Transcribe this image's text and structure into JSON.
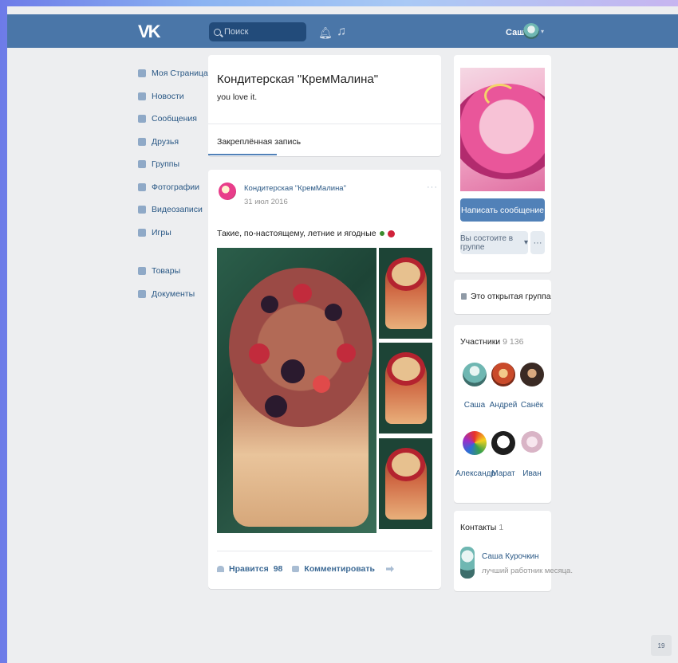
{
  "header": {
    "logo": "VK",
    "search_placeholder": "Поиск",
    "user_name": "Саша"
  },
  "sidebar": {
    "items": [
      {
        "label": "Моя Страница",
        "icon": "home-icon"
      },
      {
        "label": "Новости",
        "icon": "news-icon"
      },
      {
        "label": "Сообщения",
        "icon": "messages-icon"
      },
      {
        "label": "Друзья",
        "icon": "friends-icon"
      },
      {
        "label": "Группы",
        "icon": "groups-icon"
      },
      {
        "label": "Фотографии",
        "icon": "photos-icon"
      },
      {
        "label": "Видеозаписи",
        "icon": "videos-icon"
      },
      {
        "label": "Игры",
        "icon": "games-icon"
      }
    ],
    "extra_items": [
      {
        "label": "Товары",
        "icon": "goods-icon"
      },
      {
        "label": "Документы",
        "icon": "documents-icon"
      }
    ]
  },
  "group": {
    "title": "Кондитерская \"КремМалина\"",
    "status": "you love it.",
    "tab_pinned": "Закреплённая запись"
  },
  "post": {
    "author": "Кондитерская \"КремМалина\"",
    "date": "31 июл 2016",
    "text": "Такие, по-настоящему, летние и ягодные",
    "like_label": "Нравится",
    "like_count": "98",
    "comment_label": "Комментировать"
  },
  "right": {
    "send_message": "Написать сообщение",
    "member_status": "Вы состоите в группе",
    "open_group": "Это открытая группа",
    "members_title": "Участники",
    "members_count": "9 136",
    "members": [
      {
        "name": "Саша"
      },
      {
        "name": "Андрей"
      },
      {
        "name": "Санёк"
      },
      {
        "name": "Александр"
      },
      {
        "name": "Марат"
      },
      {
        "name": "Иван"
      }
    ],
    "contacts_title": "Контакты",
    "contacts_count": "1",
    "contact_name": "Саша Курочкин",
    "contact_role": "лучший работник месяца."
  },
  "chat_badge": "19"
}
